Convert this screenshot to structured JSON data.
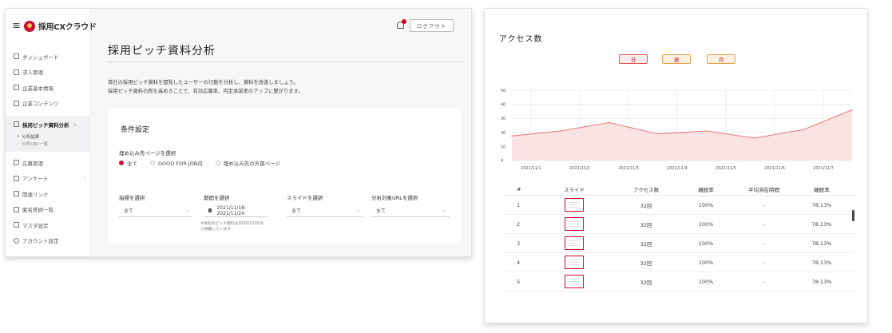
{
  "left": {
    "brand": "採用CXクラウド",
    "logout": "ログアウト",
    "page_title": "採用ピッチ資料分析",
    "desc1": "貴社の採用ピッチ資料を閲覧したユーザーの行動を分析し、資料を改善しましょう。",
    "desc2": "採用ピッチ資料の質を高めることで、有効応募率、内定承諾率のアップに繋がります。",
    "nav": [
      {
        "label": "ダッシュボード",
        "icon": "grid-icon"
      },
      {
        "label": "求人管理",
        "icon": "briefcase-icon"
      },
      {
        "label": "企業基本情報",
        "icon": "building-icon"
      },
      {
        "label": "企業コンテンツ",
        "icon": "content-icon"
      }
    ],
    "nav_active": "採用ピッチ資料分析",
    "nav_sub": [
      "分析結果",
      "分析URL一覧"
    ],
    "nav_bottom": [
      {
        "label": "応募管理",
        "icon": "inbox-icon"
      },
      {
        "label": "アンケート",
        "icon": "survey-icon"
      },
      {
        "label": "関連リンク",
        "icon": "link-icon"
      },
      {
        "label": "匿名質問一覧",
        "icon": "chat-icon"
      },
      {
        "label": "マスタ設定",
        "icon": "database-icon"
      },
      {
        "label": "アカウント設定",
        "icon": "user-icon"
      }
    ],
    "card": {
      "title": "条件設定",
      "embed_label": "埋め込み先ページを選択",
      "radios": [
        "全て",
        "GOOD FOR JOB内",
        "埋め込み先の外部ページ"
      ],
      "metric_label": "指標を選択",
      "metric_value": "全て",
      "period_label": "期間を選択",
      "period_value": "2021/11/18-2021/11/24",
      "period_note": "※現在のピッチ資料は2020/12/03から掲載しています",
      "slide_label": "スライドを選択",
      "slide_value": "全て",
      "url_label": "分析対象URLを選択",
      "url_value": "全て"
    }
  },
  "right": {
    "title": "アクセス数",
    "periods": [
      "日",
      "週",
      "月"
    ],
    "table_headers": [
      "#",
      "スライド",
      "アクセス数",
      "離脱率",
      "平均滞在時間",
      "離脱率"
    ],
    "rows": [
      {
        "no": "1",
        "access": "32回",
        "leave": "100%",
        "stay": "-",
        "rate": "78.13%"
      },
      {
        "no": "2",
        "access": "32回",
        "leave": "100%",
        "stay": "-",
        "rate": "78.13%"
      },
      {
        "no": "3",
        "access": "32回",
        "leave": "100%",
        "stay": "-",
        "rate": "78.13%"
      },
      {
        "no": "4",
        "access": "32回",
        "leave": "100%",
        "stay": "-",
        "rate": "78.13%"
      },
      {
        "no": "5",
        "access": "32回",
        "leave": "100%",
        "stay": "-",
        "rate": "78.13%"
      }
    ]
  },
  "chart_data": {
    "type": "area",
    "x": [
      "2021/11/1",
      "2021/11/2",
      "2021/11/3",
      "2021/11/4",
      "2021/11/5",
      "2021/11/6",
      "2021/11/7"
    ],
    "y_ticks": [
      "0",
      "10",
      "20",
      "30",
      "40",
      "50"
    ],
    "series": [
      {
        "values": [
          17.5,
          21,
          27,
          19,
          21,
          16,
          22,
          36
        ]
      }
    ],
    "ylim": [
      0,
      50
    ],
    "grid": true,
    "colors": {
      "line": "#e87a7a",
      "fill": "#fbe3e3"
    }
  }
}
